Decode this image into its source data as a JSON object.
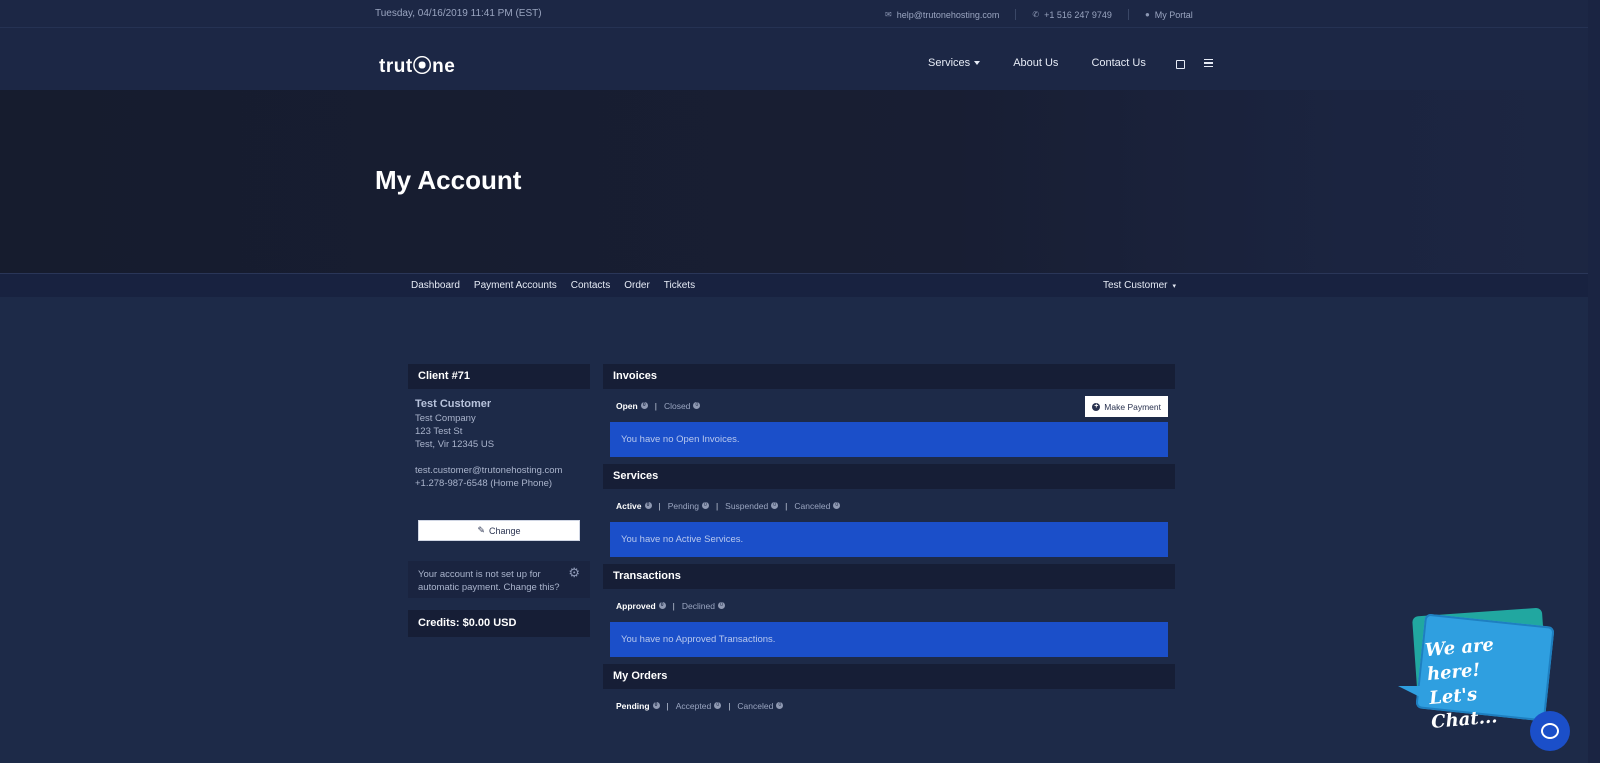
{
  "topbar": {
    "datetime": "Tuesday, 04/16/2019 11:41 PM (EST)",
    "email": "help@trutonehosting.com",
    "phone": "+1 516 247 9749",
    "portal": "My Portal"
  },
  "header": {
    "logo": "trut⦿ne",
    "nav": [
      {
        "label": "Services"
      },
      {
        "label": "About Us"
      },
      {
        "label": "Contact Us"
      }
    ]
  },
  "hero": {
    "title": "My Account"
  },
  "subnav": {
    "links": [
      "Dashboard",
      "Payment Accounts",
      "Contacts",
      "Order",
      "Tickets"
    ],
    "user": "Test Customer"
  },
  "client": {
    "heading": "Client #71",
    "name": "Test Customer",
    "company": "Test Company",
    "street": "123 Test St",
    "city": "Test, Vir 12345 US",
    "email": "test.customer@trutonehosting.com",
    "phone": "+1.278-987-6548 (Home Phone)",
    "change_label": "Change",
    "autopay_text": "Your account is not set up for automatic payment. Change this?",
    "credits": "Credits: $0.00 USD"
  },
  "invoices": {
    "title": "Invoices",
    "tabs": [
      {
        "label": "Open",
        "count": "0"
      },
      {
        "label": "Closed",
        "count": "0"
      }
    ],
    "make_payment": "Make Payment",
    "notice": "You have no Open Invoices."
  },
  "services": {
    "title": "Services",
    "tabs": [
      {
        "label": "Active",
        "count": "0"
      },
      {
        "label": "Pending",
        "count": "0"
      },
      {
        "label": "Suspended",
        "count": "0"
      },
      {
        "label": "Canceled",
        "count": "0"
      }
    ],
    "notice": "You have no Active Services."
  },
  "transactions": {
    "title": "Transactions",
    "tabs": [
      {
        "label": "Approved",
        "count": "0"
      },
      {
        "label": "Declined",
        "count": "0"
      }
    ],
    "notice": "You have no Approved Transactions."
  },
  "orders": {
    "title": "My Orders",
    "tabs": [
      {
        "label": "Pending",
        "count": "0"
      },
      {
        "label": "Accepted",
        "count": "0"
      },
      {
        "label": "Canceled",
        "count": "0"
      }
    ]
  },
  "chat": {
    "line1": "We are here!",
    "line2": "Let's Chat..."
  }
}
